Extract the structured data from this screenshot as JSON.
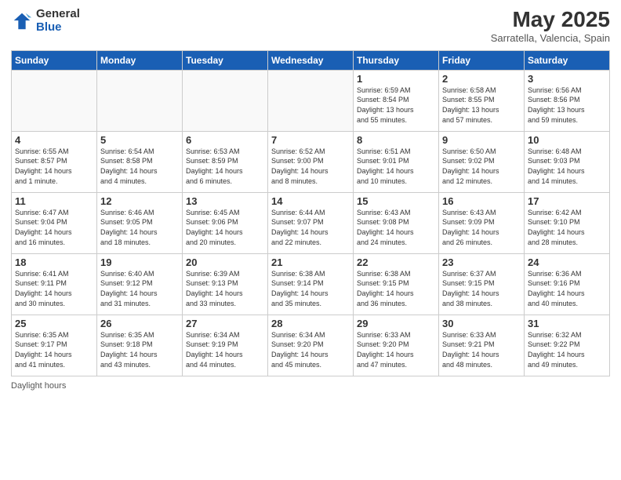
{
  "logo": {
    "line1": "General",
    "line2": "Blue"
  },
  "title": "May 2025",
  "subtitle": "Sarratella, Valencia, Spain",
  "days_header": [
    "Sunday",
    "Monday",
    "Tuesday",
    "Wednesday",
    "Thursday",
    "Friday",
    "Saturday"
  ],
  "footer": "Daylight hours",
  "weeks": [
    [
      {
        "day": "",
        "info": ""
      },
      {
        "day": "",
        "info": ""
      },
      {
        "day": "",
        "info": ""
      },
      {
        "day": "",
        "info": ""
      },
      {
        "day": "1",
        "info": "Sunrise: 6:59 AM\nSunset: 8:54 PM\nDaylight: 13 hours\nand 55 minutes."
      },
      {
        "day": "2",
        "info": "Sunrise: 6:58 AM\nSunset: 8:55 PM\nDaylight: 13 hours\nand 57 minutes."
      },
      {
        "day": "3",
        "info": "Sunrise: 6:56 AM\nSunset: 8:56 PM\nDaylight: 13 hours\nand 59 minutes."
      }
    ],
    [
      {
        "day": "4",
        "info": "Sunrise: 6:55 AM\nSunset: 8:57 PM\nDaylight: 14 hours\nand 1 minute."
      },
      {
        "day": "5",
        "info": "Sunrise: 6:54 AM\nSunset: 8:58 PM\nDaylight: 14 hours\nand 4 minutes."
      },
      {
        "day": "6",
        "info": "Sunrise: 6:53 AM\nSunset: 8:59 PM\nDaylight: 14 hours\nand 6 minutes."
      },
      {
        "day": "7",
        "info": "Sunrise: 6:52 AM\nSunset: 9:00 PM\nDaylight: 14 hours\nand 8 minutes."
      },
      {
        "day": "8",
        "info": "Sunrise: 6:51 AM\nSunset: 9:01 PM\nDaylight: 14 hours\nand 10 minutes."
      },
      {
        "day": "9",
        "info": "Sunrise: 6:50 AM\nSunset: 9:02 PM\nDaylight: 14 hours\nand 12 minutes."
      },
      {
        "day": "10",
        "info": "Sunrise: 6:48 AM\nSunset: 9:03 PM\nDaylight: 14 hours\nand 14 minutes."
      }
    ],
    [
      {
        "day": "11",
        "info": "Sunrise: 6:47 AM\nSunset: 9:04 PM\nDaylight: 14 hours\nand 16 minutes."
      },
      {
        "day": "12",
        "info": "Sunrise: 6:46 AM\nSunset: 9:05 PM\nDaylight: 14 hours\nand 18 minutes."
      },
      {
        "day": "13",
        "info": "Sunrise: 6:45 AM\nSunset: 9:06 PM\nDaylight: 14 hours\nand 20 minutes."
      },
      {
        "day": "14",
        "info": "Sunrise: 6:44 AM\nSunset: 9:07 PM\nDaylight: 14 hours\nand 22 minutes."
      },
      {
        "day": "15",
        "info": "Sunrise: 6:43 AM\nSunset: 9:08 PM\nDaylight: 14 hours\nand 24 minutes."
      },
      {
        "day": "16",
        "info": "Sunrise: 6:43 AM\nSunset: 9:09 PM\nDaylight: 14 hours\nand 26 minutes."
      },
      {
        "day": "17",
        "info": "Sunrise: 6:42 AM\nSunset: 9:10 PM\nDaylight: 14 hours\nand 28 minutes."
      }
    ],
    [
      {
        "day": "18",
        "info": "Sunrise: 6:41 AM\nSunset: 9:11 PM\nDaylight: 14 hours\nand 30 minutes."
      },
      {
        "day": "19",
        "info": "Sunrise: 6:40 AM\nSunset: 9:12 PM\nDaylight: 14 hours\nand 31 minutes."
      },
      {
        "day": "20",
        "info": "Sunrise: 6:39 AM\nSunset: 9:13 PM\nDaylight: 14 hours\nand 33 minutes."
      },
      {
        "day": "21",
        "info": "Sunrise: 6:38 AM\nSunset: 9:14 PM\nDaylight: 14 hours\nand 35 minutes."
      },
      {
        "day": "22",
        "info": "Sunrise: 6:38 AM\nSunset: 9:15 PM\nDaylight: 14 hours\nand 36 minutes."
      },
      {
        "day": "23",
        "info": "Sunrise: 6:37 AM\nSunset: 9:15 PM\nDaylight: 14 hours\nand 38 minutes."
      },
      {
        "day": "24",
        "info": "Sunrise: 6:36 AM\nSunset: 9:16 PM\nDaylight: 14 hours\nand 40 minutes."
      }
    ],
    [
      {
        "day": "25",
        "info": "Sunrise: 6:35 AM\nSunset: 9:17 PM\nDaylight: 14 hours\nand 41 minutes."
      },
      {
        "day": "26",
        "info": "Sunrise: 6:35 AM\nSunset: 9:18 PM\nDaylight: 14 hours\nand 43 minutes."
      },
      {
        "day": "27",
        "info": "Sunrise: 6:34 AM\nSunset: 9:19 PM\nDaylight: 14 hours\nand 44 minutes."
      },
      {
        "day": "28",
        "info": "Sunrise: 6:34 AM\nSunset: 9:20 PM\nDaylight: 14 hours\nand 45 minutes."
      },
      {
        "day": "29",
        "info": "Sunrise: 6:33 AM\nSunset: 9:20 PM\nDaylight: 14 hours\nand 47 minutes."
      },
      {
        "day": "30",
        "info": "Sunrise: 6:33 AM\nSunset: 9:21 PM\nDaylight: 14 hours\nand 48 minutes."
      },
      {
        "day": "31",
        "info": "Sunrise: 6:32 AM\nSunset: 9:22 PM\nDaylight: 14 hours\nand 49 minutes."
      }
    ]
  ]
}
